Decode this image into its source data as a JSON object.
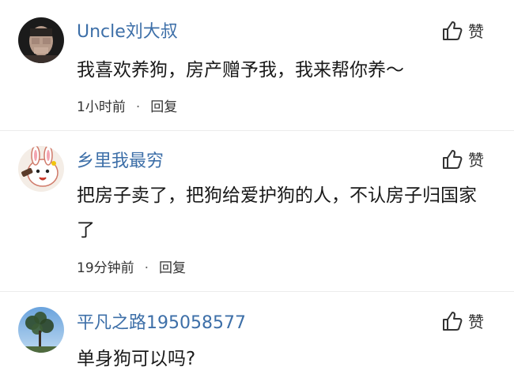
{
  "comments": [
    {
      "username": "Uncle刘大叔",
      "text": "我喜欢养狗，房产赠予我，我来帮你养～",
      "time": "1小时前",
      "reply_label": "回复",
      "like_label": "赞",
      "avatar": "blurred-face-avatar"
    },
    {
      "username": "乡里我最穷",
      "text": "把房子卖了，把狗给爱护狗的人，不认房子归国家了",
      "time": "19分钟前",
      "reply_label": "回复",
      "like_label": "赞",
      "avatar": "cartoon-rabbit-avatar"
    },
    {
      "username": "平凡之路195058577",
      "text": "单身狗可以吗?",
      "like_label": "赞",
      "avatar": "sky-tree-avatar"
    }
  ],
  "meta_separator": "·",
  "colors": {
    "username": "#3d6fa8",
    "text": "#1a1a1a",
    "meta": "#333333"
  }
}
